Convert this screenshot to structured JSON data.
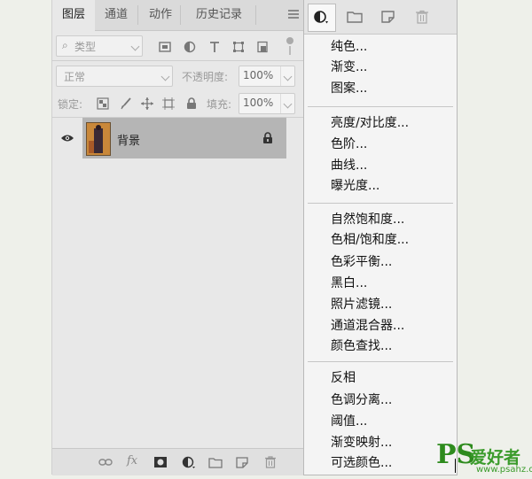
{
  "tabs": [
    {
      "label": "图层"
    },
    {
      "label": "通道"
    },
    {
      "label": "动作"
    },
    {
      "label": "历史记录"
    }
  ],
  "filter": {
    "label": "类型"
  },
  "blend_mode": {
    "value": "正常"
  },
  "opacity": {
    "label": "不透明度:",
    "value": "100%"
  },
  "lock": {
    "label": "锁定:"
  },
  "fill": {
    "label": "填充:",
    "value": "100%"
  },
  "layer": {
    "name": "背景"
  },
  "bottom_icons": [
    "link-icon",
    "fx-icon",
    "mask-icon",
    "adjustment-icon",
    "folder-icon",
    "new-layer-icon",
    "trash-icon"
  ],
  "fx_label": "fx",
  "menu": {
    "group1": [
      "纯色...",
      "渐变...",
      "图案..."
    ],
    "group2": [
      "亮度/对比度...",
      "色阶...",
      "曲线...",
      "曝光度..."
    ],
    "group3": [
      "自然饱和度...",
      "色相/饱和度...",
      "色彩平衡...",
      "黑白...",
      "照片滤镜...",
      "通道混合器...",
      "颜色查找..."
    ],
    "group4": [
      "反相",
      "色调分离...",
      "阈值...",
      "渐变映射...",
      "可选颜色..."
    ]
  },
  "watermark": {
    "ps": "PS",
    "cn": "爱好者",
    "url": "www.psahz.com"
  },
  "colors": {
    "panel_bg": "#e8e8e8",
    "selected_layer": "#b5b5b5",
    "menu_bg": "#f4f4f4",
    "watermark": "#2e8b1e"
  }
}
